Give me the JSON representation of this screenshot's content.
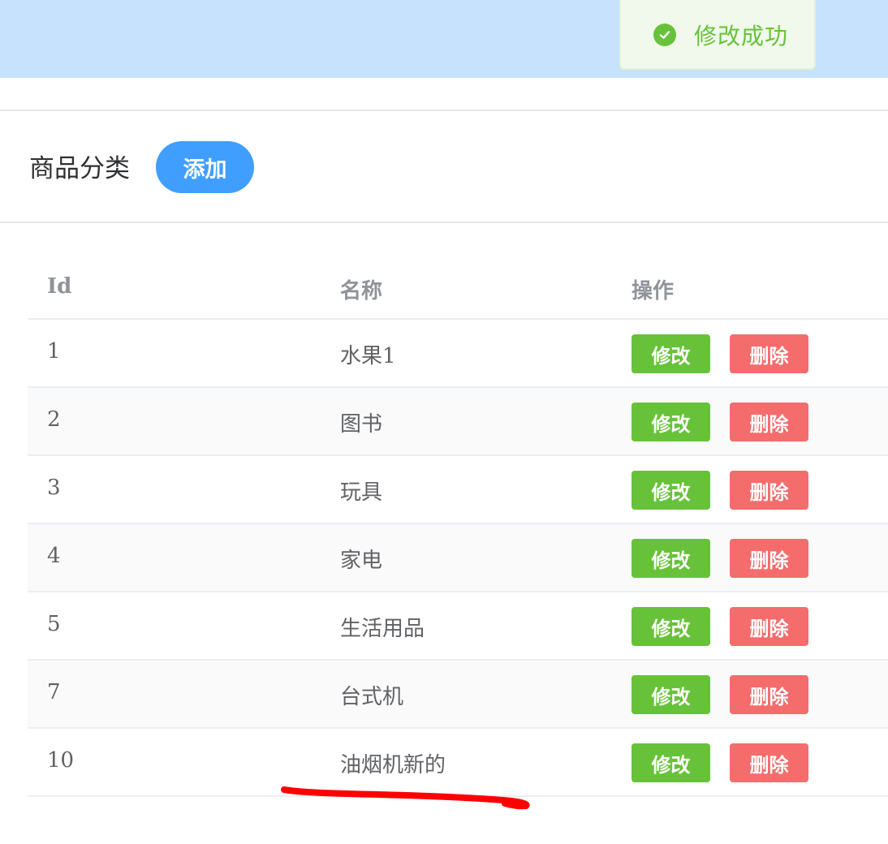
{
  "toast": {
    "icon": "check-circle-icon",
    "message": "修改成功",
    "color": "#67c23a"
  },
  "section": {
    "title": "商品分类",
    "add_button": "添加"
  },
  "table": {
    "columns": [
      "Id",
      "名称",
      "操作"
    ],
    "edit_label": "修改",
    "delete_label": "删除",
    "rows": [
      {
        "id": "1",
        "name": "水果1"
      },
      {
        "id": "2",
        "name": "图书"
      },
      {
        "id": "3",
        "name": "玩具"
      },
      {
        "id": "4",
        "name": "家电"
      },
      {
        "id": "5",
        "name": "生活用品"
      },
      {
        "id": "7",
        "name": "台式机"
      },
      {
        "id": "10",
        "name": "油烟机新的"
      }
    ]
  },
  "colors": {
    "header_bg": "#c6e2fc",
    "primary": "#409eff",
    "success": "#67c23a",
    "danger": "#f56c6c",
    "annotation": "#ff0000"
  }
}
